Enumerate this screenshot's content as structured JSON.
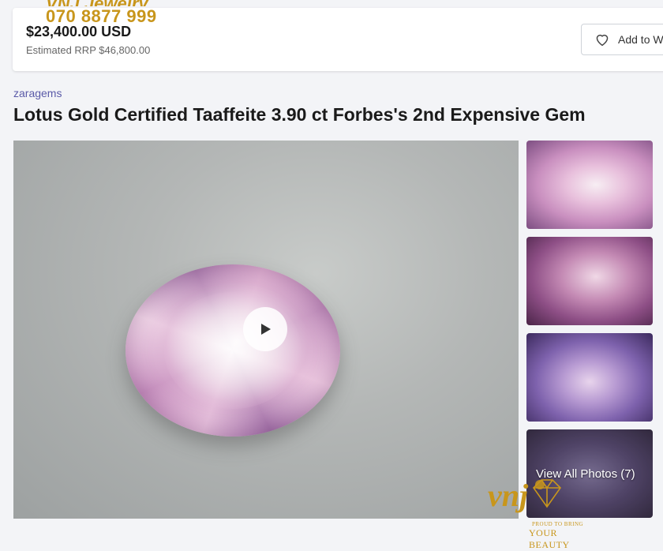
{
  "watermark": {
    "brand": "VNJ Jewelry",
    "phone": "070 8877 999"
  },
  "listing": {
    "price": "$23,400.00 USD",
    "rrp": "Estimated RRP $46,800.00",
    "watch_label": "Add to W",
    "seller": "zaragems",
    "title": "Lotus Gold Certified Taaffeite 3.90 ct Forbes's 2nd Expensive Gem"
  },
  "gallery": {
    "view_all": "View All Photos (7)"
  },
  "logo": {
    "mark": "vnj",
    "tagline_1": "PROUD TO BRING",
    "tagline_2": "YOUR BEAUTY"
  },
  "colors": {
    "accent_gold": "#c8961c",
    "seller_link": "#5a5aa8",
    "gem_pink": "#e6b4d6"
  }
}
